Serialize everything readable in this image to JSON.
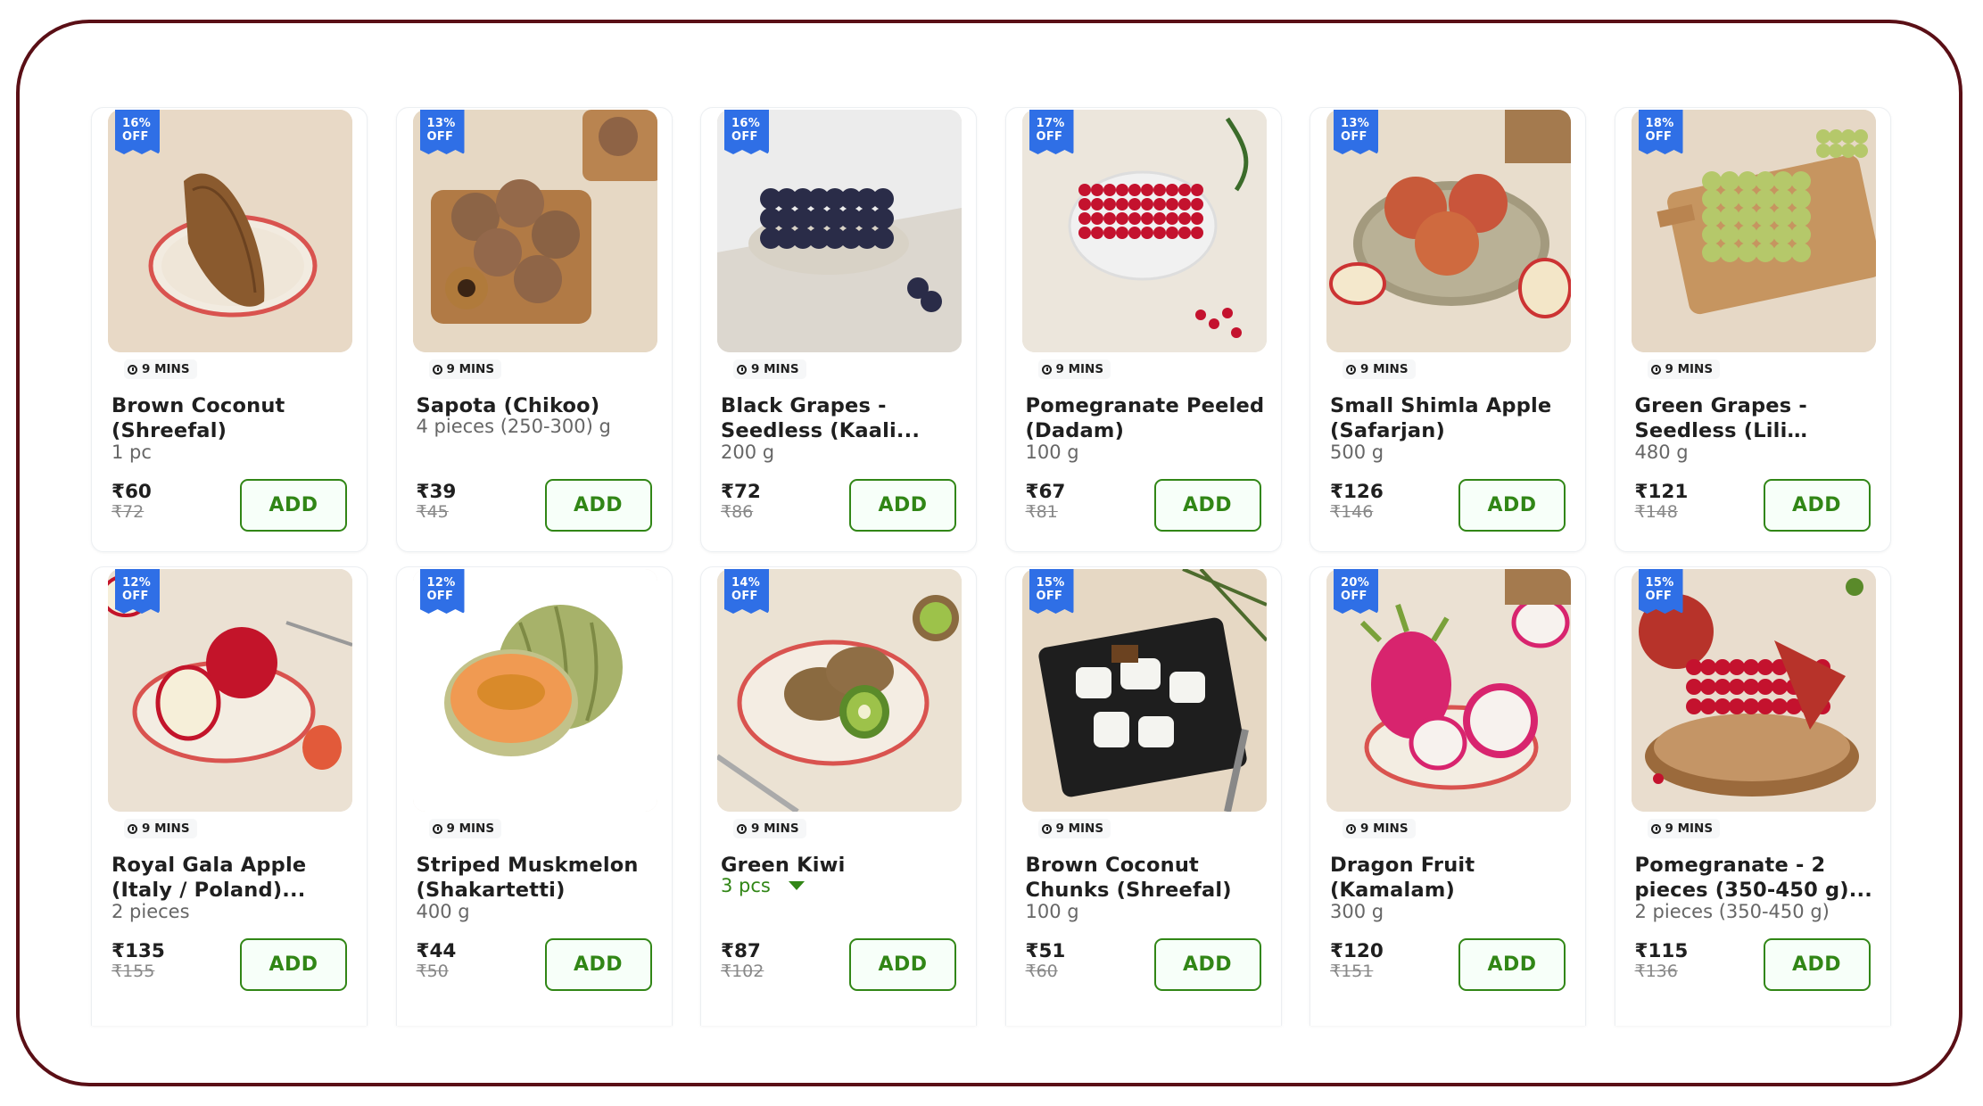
{
  "colors": {
    "frame": "#5a0f16",
    "badge": "#2f6fe6",
    "add_green": "#318616"
  },
  "products": [
    {
      "discount_pct": "16%",
      "discount_off": "OFF",
      "eta": "9 MINS",
      "name": "Brown Coconut (Shreefal)",
      "qty": "1 pc",
      "price": "₹60",
      "mrp": "₹72",
      "add": "ADD",
      "image": "coconut"
    },
    {
      "discount_pct": "13%",
      "discount_off": "OFF",
      "eta": "9 MINS",
      "name": "Sapota (Chikoo)",
      "qty": "4 pieces (250-300) g",
      "price": "₹39",
      "mrp": "₹45",
      "add": "ADD",
      "image": "chikoo"
    },
    {
      "discount_pct": "16%",
      "discount_off": "OFF",
      "eta": "9 MINS",
      "name": "Black Grapes - Seedless (Kaali...",
      "qty": "200 g",
      "price": "₹72",
      "mrp": "₹86",
      "add": "ADD",
      "image": "black-grapes"
    },
    {
      "discount_pct": "17%",
      "discount_off": "OFF",
      "eta": "9 MINS",
      "name": "Pomegranate Peeled (Dadam)",
      "qty": "100 g",
      "price": "₹67",
      "mrp": "₹81",
      "add": "ADD",
      "image": "pomegranate-bowl"
    },
    {
      "discount_pct": "13%",
      "discount_off": "OFF",
      "eta": "9 MINS",
      "name": "Small Shimla Apple (Safarjan)",
      "qty": "500 g",
      "price": "₹126",
      "mrp": "₹146",
      "add": "ADD",
      "image": "shimla-apple"
    },
    {
      "discount_pct": "18%",
      "discount_off": "OFF",
      "eta": "9 MINS",
      "name": "Green Grapes - Seedless (Lili Draaksh)",
      "qty": "480 g",
      "price": "₹121",
      "mrp": "₹148",
      "add": "ADD",
      "image": "green-grapes"
    },
    {
      "discount_pct": "12%",
      "discount_off": "OFF",
      "eta": "9 MINS",
      "name": "Royal Gala Apple (Italy / Poland)...",
      "qty": "2 pieces",
      "price": "₹135",
      "mrp": "₹155",
      "add": "ADD",
      "image": "gala-apple"
    },
    {
      "discount_pct": "12%",
      "discount_off": "OFF",
      "eta": "9 MINS",
      "name": "Striped Muskmelon (Shakartetti)",
      "qty": "400 g",
      "price": "₹44",
      "mrp": "₹50",
      "add": "ADD",
      "image": "muskmelon"
    },
    {
      "discount_pct": "14%",
      "discount_off": "OFF",
      "eta": "9 MINS",
      "name": "Green Kiwi",
      "qty": "3 pcs",
      "qty_selectable": true,
      "price": "₹87",
      "mrp": "₹102",
      "add": "ADD",
      "image": "kiwi"
    },
    {
      "discount_pct": "15%",
      "discount_off": "OFF",
      "eta": "9 MINS",
      "name": "Brown Coconut Chunks (Shreefal)",
      "qty": "100 g",
      "price": "₹51",
      "mrp": "₹60",
      "add": "ADD",
      "image": "coconut-chunks"
    },
    {
      "discount_pct": "20%",
      "discount_off": "OFF",
      "eta": "9 MINS",
      "name": "Dragon Fruit (Kamalam)",
      "qty": "300 g",
      "price": "₹120",
      "mrp": "₹151",
      "add": "ADD",
      "image": "dragon-fruit"
    },
    {
      "discount_pct": "15%",
      "discount_off": "OFF",
      "eta": "9 MINS",
      "name": "Pomegranate - 2 pieces (350-450 g)...",
      "qty": "2 pieces (350-450 g)",
      "price": "₹115",
      "mrp": "₹136",
      "add": "ADD",
      "image": "pomegranate"
    }
  ]
}
